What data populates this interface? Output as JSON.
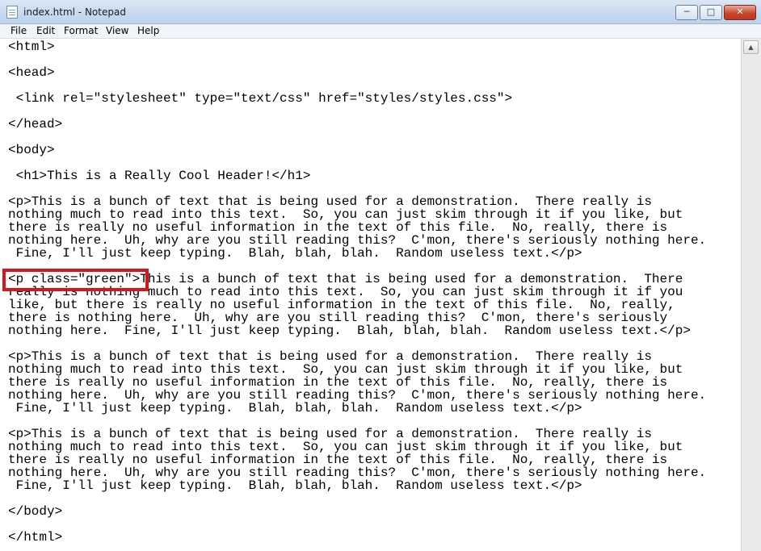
{
  "window": {
    "title": "index.html - Notepad",
    "buttons": {
      "minimize": "─",
      "maximize": "□",
      "close": "✕"
    },
    "app_icon": "notepad-icon"
  },
  "menu": [
    "File",
    "Edit",
    "Format",
    "View",
    "Help"
  ],
  "document": {
    "lines": [
      "<html>",
      "",
      "<head>",
      "",
      " <link rel=\"stylesheet\" type=\"text/css\" href=\"styles/styles.css\">",
      "",
      "</head>",
      "",
      "<body>",
      "",
      " <h1>This is a Really Cool Header!</h1>",
      "",
      "<p>This is a bunch of text that is being used for a demonstration.  There really is",
      "nothing much to read into this text.  So, you can just skim through it if you like, but",
      "there is really no useful information in the text of this file.  No, really, there is",
      "nothing here.  Uh, why are you still reading this?  C'mon, there's seriously nothing here.",
      " Fine, I'll just keep typing.  Blah, blah, blah.  Random useless text.</p>",
      "",
      "<p class=\"green\">This is a bunch of text that is being used for a demonstration.  There",
      "really is nothing much to read into this text.  So, you can just skim through it if you",
      "like, but there is really no useful information in the text of this file.  No, really,",
      "there is nothing here.  Uh, why are you still reading this?  C'mon, there's seriously",
      "nothing here.  Fine, I'll just keep typing.  Blah, blah, blah.  Random useless text.</p>",
      "",
      "<p>This is a bunch of text that is being used for a demonstration.  There really is",
      "nothing much to read into this text.  So, you can just skim through it if you like, but",
      "there is really no useful information in the text of this file.  No, really, there is",
      "nothing here.  Uh, why are you still reading this?  C'mon, there's seriously nothing here.",
      " Fine, I'll just keep typing.  Blah, blah, blah.  Random useless text.</p>",
      "",
      "<p>This is a bunch of text that is being used for a demonstration.  There really is",
      "nothing much to read into this text.  So, you can just skim through it if you like, but",
      "there is really no useful information in the text of this file.  No, really, there is",
      "nothing here.  Uh, why are you still reading this?  C'mon, there's seriously nothing here.",
      " Fine, I'll just keep typing.  Blah, blah, blah.  Random useless text.</p>",
      "",
      "</body>",
      "",
      "</html>"
    ]
  },
  "annotation": {
    "color": "#d4171e",
    "target": "<p class=\"green\">"
  },
  "scrollbar": {
    "up_arrow": "▲"
  }
}
